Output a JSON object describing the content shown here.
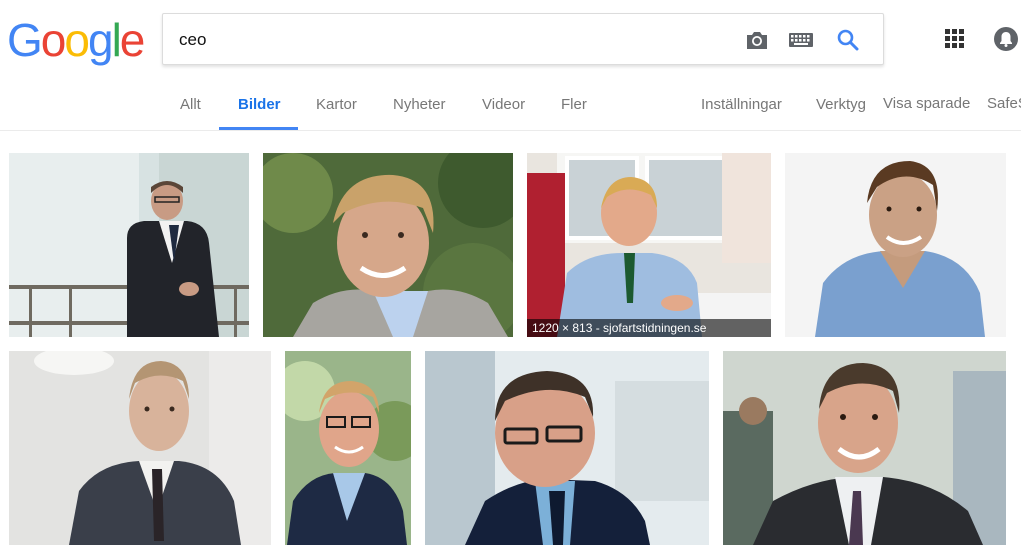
{
  "logo": {
    "letters": [
      "G",
      "o",
      "o",
      "g",
      "l",
      "e"
    ],
    "colors": [
      "#4285F4",
      "#EA4335",
      "#FBBC05",
      "#4285F4",
      "#34A853",
      "#EA4335"
    ]
  },
  "search": {
    "value": "ceo",
    "placeholder": ""
  },
  "icons": {
    "camera": "camera-icon",
    "keyboard": "keyboard-icon",
    "search": "search-icon",
    "apps": "apps-grid-icon",
    "notifications": "notifications-icon"
  },
  "nav": {
    "tabs": [
      {
        "label": "Allt",
        "active": false
      },
      {
        "label": "Bilder",
        "active": true
      },
      {
        "label": "Kartor",
        "active": false
      },
      {
        "label": "Nyheter",
        "active": false
      },
      {
        "label": "Videor",
        "active": false
      },
      {
        "label": "Fler",
        "active": false
      }
    ],
    "settings": "Inställningar",
    "tools": "Verktyg",
    "saved": "Visa sparade",
    "safesearch": "SafeS"
  },
  "results": {
    "images": [
      {
        "caption": ""
      },
      {
        "caption": ""
      },
      {
        "caption": "1220 × 813 - sjofartstidningen.se"
      },
      {
        "caption": ""
      },
      {
        "caption": ""
      },
      {
        "caption": ""
      },
      {
        "caption": ""
      },
      {
        "caption": ""
      }
    ]
  },
  "colors": {
    "accent": "#4285f4",
    "tab_active": "#1a73e8",
    "tab_text": "#777777"
  }
}
